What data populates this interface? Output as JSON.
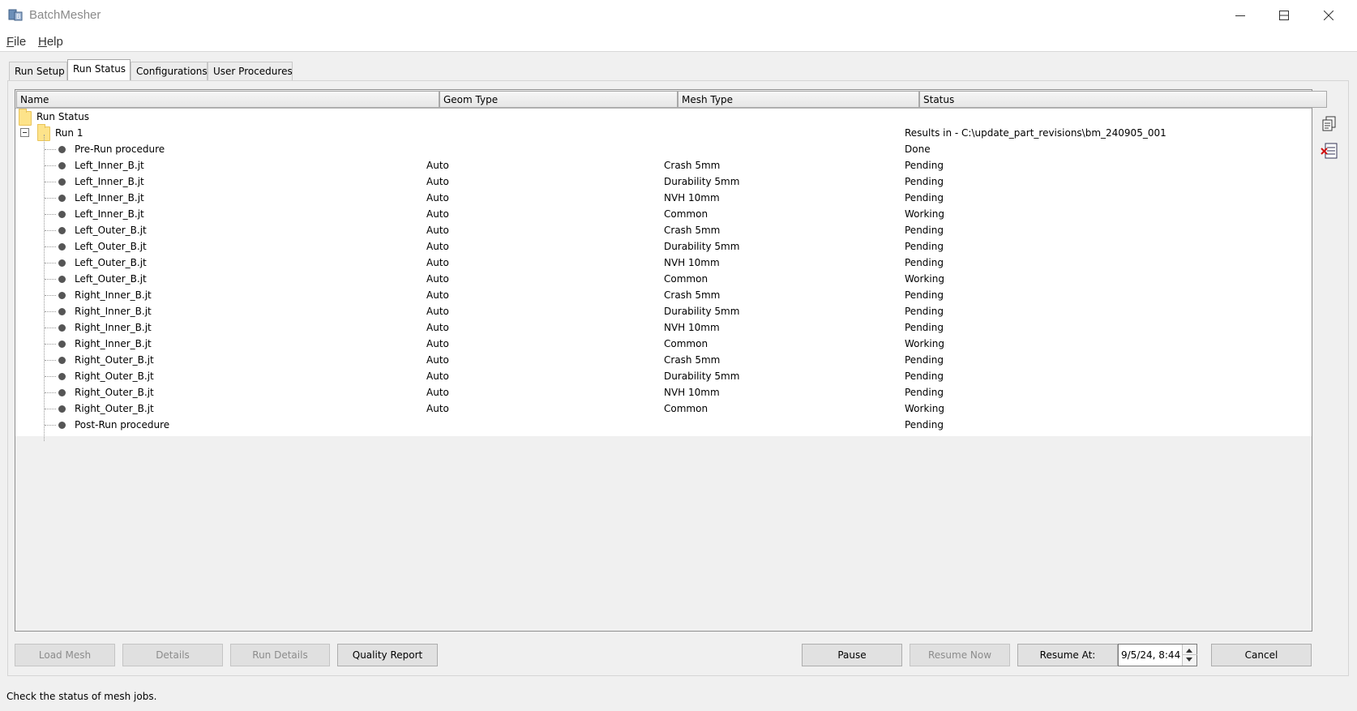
{
  "window": {
    "title": "BatchMesher"
  },
  "menu": {
    "file_prefix": "F",
    "file_rest": "ile",
    "help_prefix": "H",
    "help_rest": "elp"
  },
  "tabs": [
    {
      "label": "Run Setup"
    },
    {
      "label": "Run Status"
    },
    {
      "label": "Configurations"
    },
    {
      "label": "User Procedures"
    }
  ],
  "table": {
    "columns": [
      "Name",
      "Geom Type",
      "Mesh Type",
      "Status"
    ],
    "root_label": "Run Status",
    "run": {
      "label": "Run 1",
      "status": "Results in - C:\\update_part_revisions\\bm_240905_001"
    },
    "rows": [
      {
        "name": "Pre-Run procedure",
        "geom": "",
        "mesh": "",
        "status": "Done"
      },
      {
        "name": "Left_Inner_B.jt",
        "geom": "Auto",
        "mesh": "Crash 5mm",
        "status": "Pending"
      },
      {
        "name": "Left_Inner_B.jt",
        "geom": "Auto",
        "mesh": "Durability 5mm",
        "status": "Pending"
      },
      {
        "name": "Left_Inner_B.jt",
        "geom": "Auto",
        "mesh": "NVH 10mm",
        "status": "Pending"
      },
      {
        "name": "Left_Inner_B.jt",
        "geom": "Auto",
        "mesh": "Common",
        "status": "Working"
      },
      {
        "name": "Left_Outer_B.jt",
        "geom": "Auto",
        "mesh": "Crash 5mm",
        "status": "Pending"
      },
      {
        "name": "Left_Outer_B.jt",
        "geom": "Auto",
        "mesh": "Durability 5mm",
        "status": "Pending"
      },
      {
        "name": "Left_Outer_B.jt",
        "geom": "Auto",
        "mesh": "NVH 10mm",
        "status": "Pending"
      },
      {
        "name": "Left_Outer_B.jt",
        "geom": "Auto",
        "mesh": "Common",
        "status": "Working"
      },
      {
        "name": "Right_Inner_B.jt",
        "geom": "Auto",
        "mesh": "Crash 5mm",
        "status": "Pending"
      },
      {
        "name": "Right_Inner_B.jt",
        "geom": "Auto",
        "mesh": "Durability 5mm",
        "status": "Pending"
      },
      {
        "name": "Right_Inner_B.jt",
        "geom": "Auto",
        "mesh": "NVH 10mm",
        "status": "Pending"
      },
      {
        "name": "Right_Inner_B.jt",
        "geom": "Auto",
        "mesh": "Common",
        "status": "Working"
      },
      {
        "name": "Right_Outer_B.jt",
        "geom": "Auto",
        "mesh": "Crash 5mm",
        "status": "Pending"
      },
      {
        "name": "Right_Outer_B.jt",
        "geom": "Auto",
        "mesh": "Durability 5mm",
        "status": "Pending"
      },
      {
        "name": "Right_Outer_B.jt",
        "geom": "Auto",
        "mesh": "NVH 10mm",
        "status": "Pending"
      },
      {
        "name": "Right_Outer_B.jt",
        "geom": "Auto",
        "mesh": "Common",
        "status": "Working"
      },
      {
        "name": "Post-Run procedure",
        "geom": "",
        "mesh": "",
        "status": "Pending"
      }
    ]
  },
  "buttons": {
    "load_mesh": "Load Mesh",
    "details": "Details",
    "run_details": "Run Details",
    "quality_report": "Quality Report",
    "pause": "Pause",
    "resume_now": "Resume Now",
    "resume_at": "Resume At:",
    "cancel": "Cancel"
  },
  "resume_time": "9/5/24, 8:44",
  "status_bar": "Check the status of mesh jobs."
}
